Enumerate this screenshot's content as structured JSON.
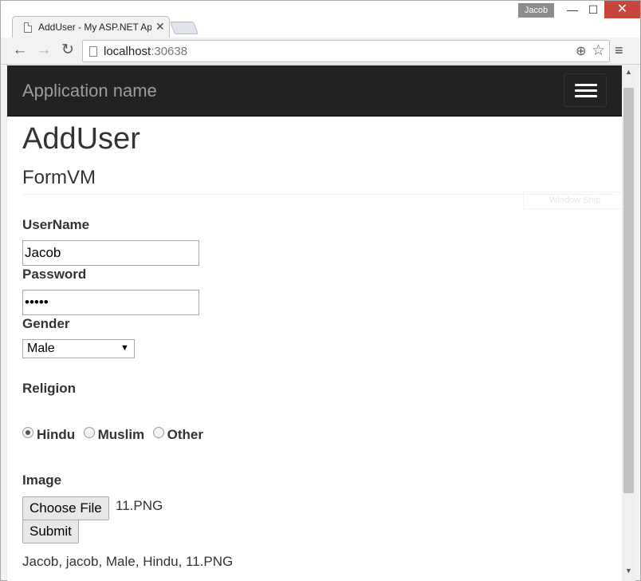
{
  "window": {
    "user_badge": "Jacob",
    "minimize_glyph": "—",
    "maximize_glyph": "☐",
    "close_glyph": "✕"
  },
  "tab": {
    "title": "AddUser - My ASP.NET Application",
    "close_glyph": "✕",
    "icon": "page-icon"
  },
  "toolbar": {
    "back_glyph": "←",
    "forward_glyph": "→",
    "reload_glyph": "↻",
    "url_host": "localhost",
    "url_port": ":30638",
    "zoom_glyph": "⊕",
    "star_glyph": "☆",
    "menu_glyph": "≡"
  },
  "navbar": {
    "brand": "Application name"
  },
  "page": {
    "title": "AddUser",
    "subtitle": "FormVM",
    "snip_overlay": "Window Snip"
  },
  "form": {
    "username_label": "UserName",
    "username_value": "Jacob",
    "password_label": "Password",
    "password_value": "jacob",
    "gender_label": "Gender",
    "gender_selected": "Male",
    "gender_arrow": "▼",
    "religion_label": "Religion",
    "religion_options": [
      "Hindu",
      "Muslim",
      "Other"
    ],
    "religion_selected": "Hindu",
    "image_label": "Image",
    "choose_file_label": "Choose File",
    "file_name": "11.PNG",
    "submit_label": "Submit"
  },
  "result": {
    "text": "Jacob, jacob, Male, Hindu, 11.PNG"
  },
  "scrollbar": {
    "up_glyph": "▲",
    "down_glyph": "▼"
  }
}
